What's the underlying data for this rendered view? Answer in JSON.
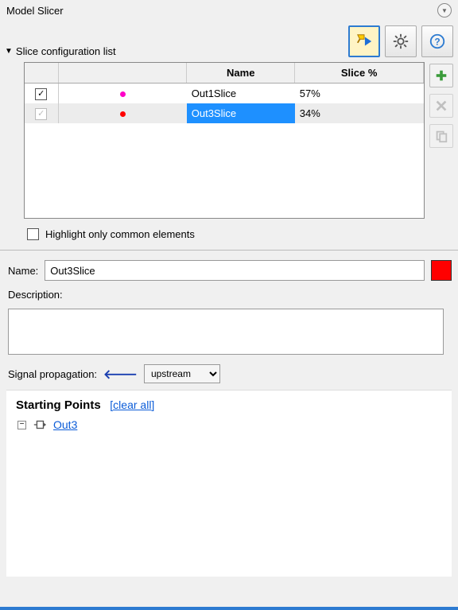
{
  "title": "Model Slicer",
  "section_title": "Slice configuration list",
  "columns": {
    "name": "Name",
    "pct": "Slice %"
  },
  "rows": [
    {
      "checked": true,
      "checkStyle": "dark",
      "dotColor": "#ff00c8",
      "name": "Out1Slice",
      "pct": "57%",
      "selected": false
    },
    {
      "checked": true,
      "checkStyle": "grey",
      "dotColor": "#ff0000",
      "name": "Out3Slice",
      "pct": "34%",
      "selected": true
    }
  ],
  "highlight_label": "Highlight only common elements",
  "highlight_checked": false,
  "form": {
    "name_label": "Name:",
    "name_value": "Out3Slice",
    "color": "#ff0000",
    "desc_label": "Description:",
    "desc_value": "",
    "sig_label": "Signal propagation:",
    "sig_value": "upstream"
  },
  "starting_points": {
    "title": "Starting Points",
    "clear": "[clear all]",
    "item": "Out3 "
  },
  "icons": {
    "highlight_tool": "highlight-tool-icon",
    "gear": "gear-icon",
    "help": "help-icon",
    "add": "add-icon",
    "delete": "delete-icon",
    "copy": "copy-icon"
  }
}
